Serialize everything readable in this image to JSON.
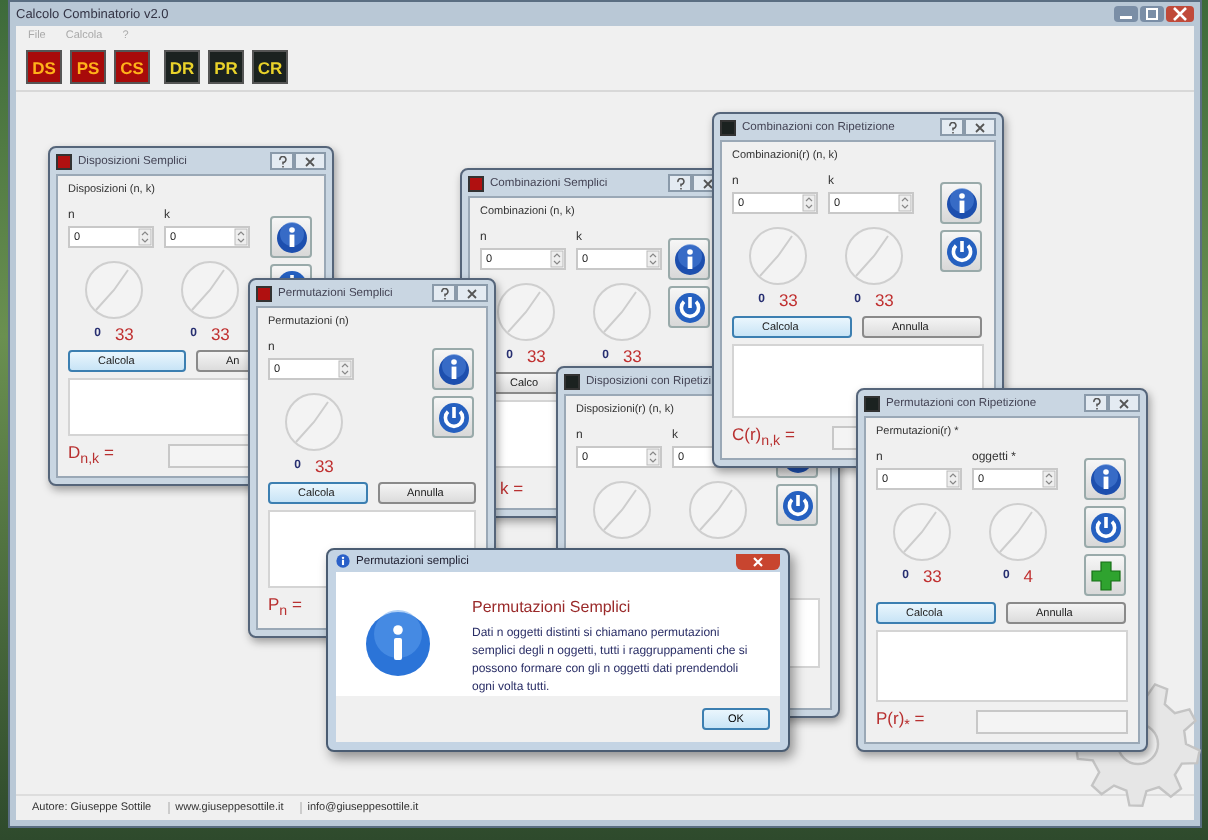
{
  "app_title": "Calcolo Combinatorio v2.0",
  "menu": [
    "File",
    "Calcola",
    "?"
  ],
  "toolbar": [
    {
      "label": "DS",
      "kind": "simple"
    },
    {
      "label": "PS",
      "kind": "simple"
    },
    {
      "label": "CS",
      "kind": "simple"
    },
    {
      "label": "DR",
      "kind": "repetition"
    },
    {
      "label": "PR",
      "kind": "repetition"
    },
    {
      "label": "CR",
      "kind": "repetition"
    }
  ],
  "windows": [
    {
      "title": "Disposizioni Semplici",
      "kind": "simple",
      "group": "Disposizioni (n, k)",
      "params": [
        {
          "label": "n",
          "value": "0"
        },
        {
          "label": "k",
          "value": "0"
        }
      ],
      "dials": [
        {
          "kind": "knob",
          "value": "0",
          "max": "33"
        },
        {
          "kind": "knob",
          "value": "0",
          "max": "33"
        }
      ],
      "tools": [
        {
          "kind": "info"
        },
        {
          "kind": "power"
        }
      ],
      "buttons": [
        {
          "label": "Calcola",
          "default": true
        },
        {
          "label": "An",
          "default": false
        }
      ],
      "result_label": "D$_{n,k}$ ="
    },
    {
      "title": "Combinazioni Semplici",
      "kind": "simple",
      "group": "Combinazioni (n, k)",
      "params": [
        {
          "label": "n",
          "value": "0"
        },
        {
          "label": "k",
          "value": "0"
        }
      ],
      "dials": [
        {
          "kind": "knob",
          "value": "0",
          "max": "33"
        },
        {
          "kind": "knob",
          "value": "0",
          "max": "33"
        }
      ],
      "tools": [
        {
          "kind": "info"
        },
        {
          "kind": "power"
        }
      ],
      "buttons": [
        {
          "label": "Calco",
          "default": false
        }
      ],
      "result_label": "k ="
    },
    {
      "title": "Permutazioni Semplici",
      "kind": "simple",
      "group": "Permutazioni (n)",
      "params": [
        {
          "label": "n",
          "value": "0"
        }
      ],
      "dials": [
        {
          "kind": "knob",
          "value": "0",
          "max": "33"
        }
      ],
      "tools": [
        {
          "kind": "info"
        },
        {
          "kind": "power"
        }
      ],
      "buttons": [
        {
          "label": "Calcola",
          "default": true
        },
        {
          "label": "Annulla",
          "default": false
        }
      ],
      "result_label": "P$_{n}$ ="
    },
    {
      "title": "Disposizioni con Ripetizi",
      "kind": "repetition",
      "group": "Disposizioni(r) (n, k)",
      "params": [
        {
          "label": "n",
          "value": "0"
        },
        {
          "label": "k",
          "value": "0"
        }
      ],
      "dials": [
        {
          "kind": "knob"
        },
        {
          "kind": "knob"
        }
      ],
      "tools": [
        {
          "kind": "info"
        },
        {
          "kind": "power"
        }
      ]
    },
    {
      "title": "Combinazioni con Ripetizione",
      "kind": "repetition",
      "group": "Combinazioni(r) (n, k)",
      "params": [
        {
          "label": "n",
          "value": "0"
        },
        {
          "label": "k",
          "value": "0"
        }
      ],
      "dials": [
        {
          "kind": "knob",
          "value": "0",
          "max": "33"
        },
        {
          "kind": "knob",
          "value": "0",
          "max": "33"
        }
      ],
      "tools": [
        {
          "kind": "info"
        },
        {
          "kind": "power"
        }
      ],
      "buttons": [
        {
          "label": "Calcola",
          "default": true
        },
        {
          "label": "Annulla",
          "default": false
        }
      ],
      "result_label": "C(r)$_{n,k}$ ="
    },
    {
      "title": "Permutazioni con Ripetizione",
      "kind": "repetition",
      "group": "Permutazioni(r) *",
      "params": [
        {
          "label": "n",
          "value": "0"
        },
        {
          "label": "oggetti *",
          "value": "0"
        }
      ],
      "dials": [
        {
          "kind": "knob",
          "value": "0",
          "max": "33"
        },
        {
          "kind": "knob",
          "value": "0",
          "max": "4"
        }
      ],
      "tools": [
        {
          "kind": "info"
        },
        {
          "kind": "power"
        },
        {
          "kind": "plus"
        }
      ],
      "buttons": [
        {
          "label": "Calcola",
          "default": true
        },
        {
          "label": "Annulla",
          "default": false
        }
      ],
      "result_label": "P(r)$_{*}$ ="
    }
  ],
  "message_box": {
    "title": "Permutazioni semplici",
    "heading": "Permutazioni Semplici",
    "text": "Dati n oggetti distinti si chiamano permutazioni semplici degli n oggetti, tutti i raggruppamenti che si possono formare con gli n oggetti dati prendendoli ogni volta tutti.",
    "button": "OK"
  },
  "status_bar": [
    "Autore: Giuseppe Sottile",
    "www.giuseppesottile.it",
    "info@giuseppesottile.it"
  ]
}
